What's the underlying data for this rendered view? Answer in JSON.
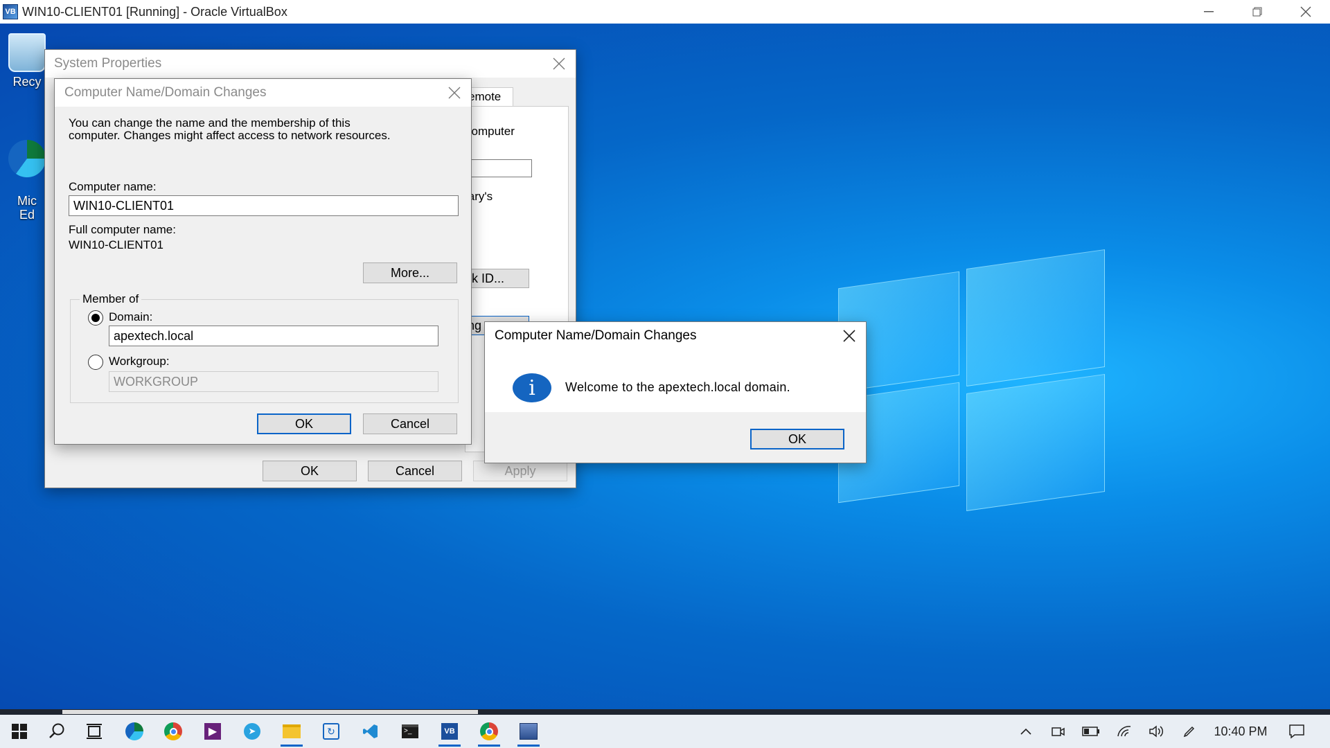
{
  "host": {
    "title": "WIN10-CLIENT01 [Running] - Oracle VirtualBox",
    "icon": "virtualbox-icon",
    "controls": [
      "minimize-icon",
      "restore-icon",
      "close-icon"
    ]
  },
  "desktop": {
    "icons": [
      {
        "label": "Recy",
        "icon": "recycle-bin-icon"
      },
      {
        "label": "Mic\nEd",
        "icon": "edge-icon"
      }
    ]
  },
  "system_properties": {
    "title": "System Properties",
    "tab_fragment": "emote",
    "frag_computer": "computer",
    "frag_larys": "lary's",
    "frag_network_id": "rk ID...",
    "frag_change": "ng",
    "ok": "OK",
    "cancel": "Cancel",
    "apply": "Apply"
  },
  "name_changes": {
    "title": "Computer Name/Domain Changes",
    "description_line1": "You can change the name and the membership of this",
    "description_line2": "computer. Changes might affect access to network resources.",
    "computer_name_label": "Computer name:",
    "computer_name_value": "WIN10-CLIENT01",
    "full_name_label": "Full computer name:",
    "full_name_value": "WIN10-CLIENT01",
    "more_button": "More...",
    "member_of_label": "Member of",
    "domain_label": "Domain:",
    "domain_value": "apextech.local",
    "workgroup_label": "Workgroup:",
    "workgroup_value": "WORKGROUP",
    "ok": "OK",
    "cancel": "Cancel"
  },
  "welcome_dialog": {
    "title": "Computer Name/Domain Changes",
    "message": "Welcome to the apextech.local domain.",
    "icon": "info-icon",
    "ok": "OK"
  },
  "taskbar": {
    "apps": [
      "start-icon",
      "search-icon",
      "task-view-icon",
      "edge-icon",
      "chrome-icon",
      "visual-studio-icon",
      "telegram-icon",
      "file-explorer-icon",
      "remote-desktop-icon",
      "vscode-icon",
      "terminal-icon",
      "virtualbox-icon",
      "chrome-profile-icon",
      "system-properties-icon"
    ],
    "time": "10:40 PM",
    "tray_icons": [
      "chevron-up-icon",
      "meet-now-icon",
      "battery-icon",
      "wifi-icon",
      "volume-icon",
      "pen-icon",
      "notification-icon"
    ]
  },
  "colors": {
    "accent": "#0a64c8",
    "desktop": "#0a8de8"
  }
}
